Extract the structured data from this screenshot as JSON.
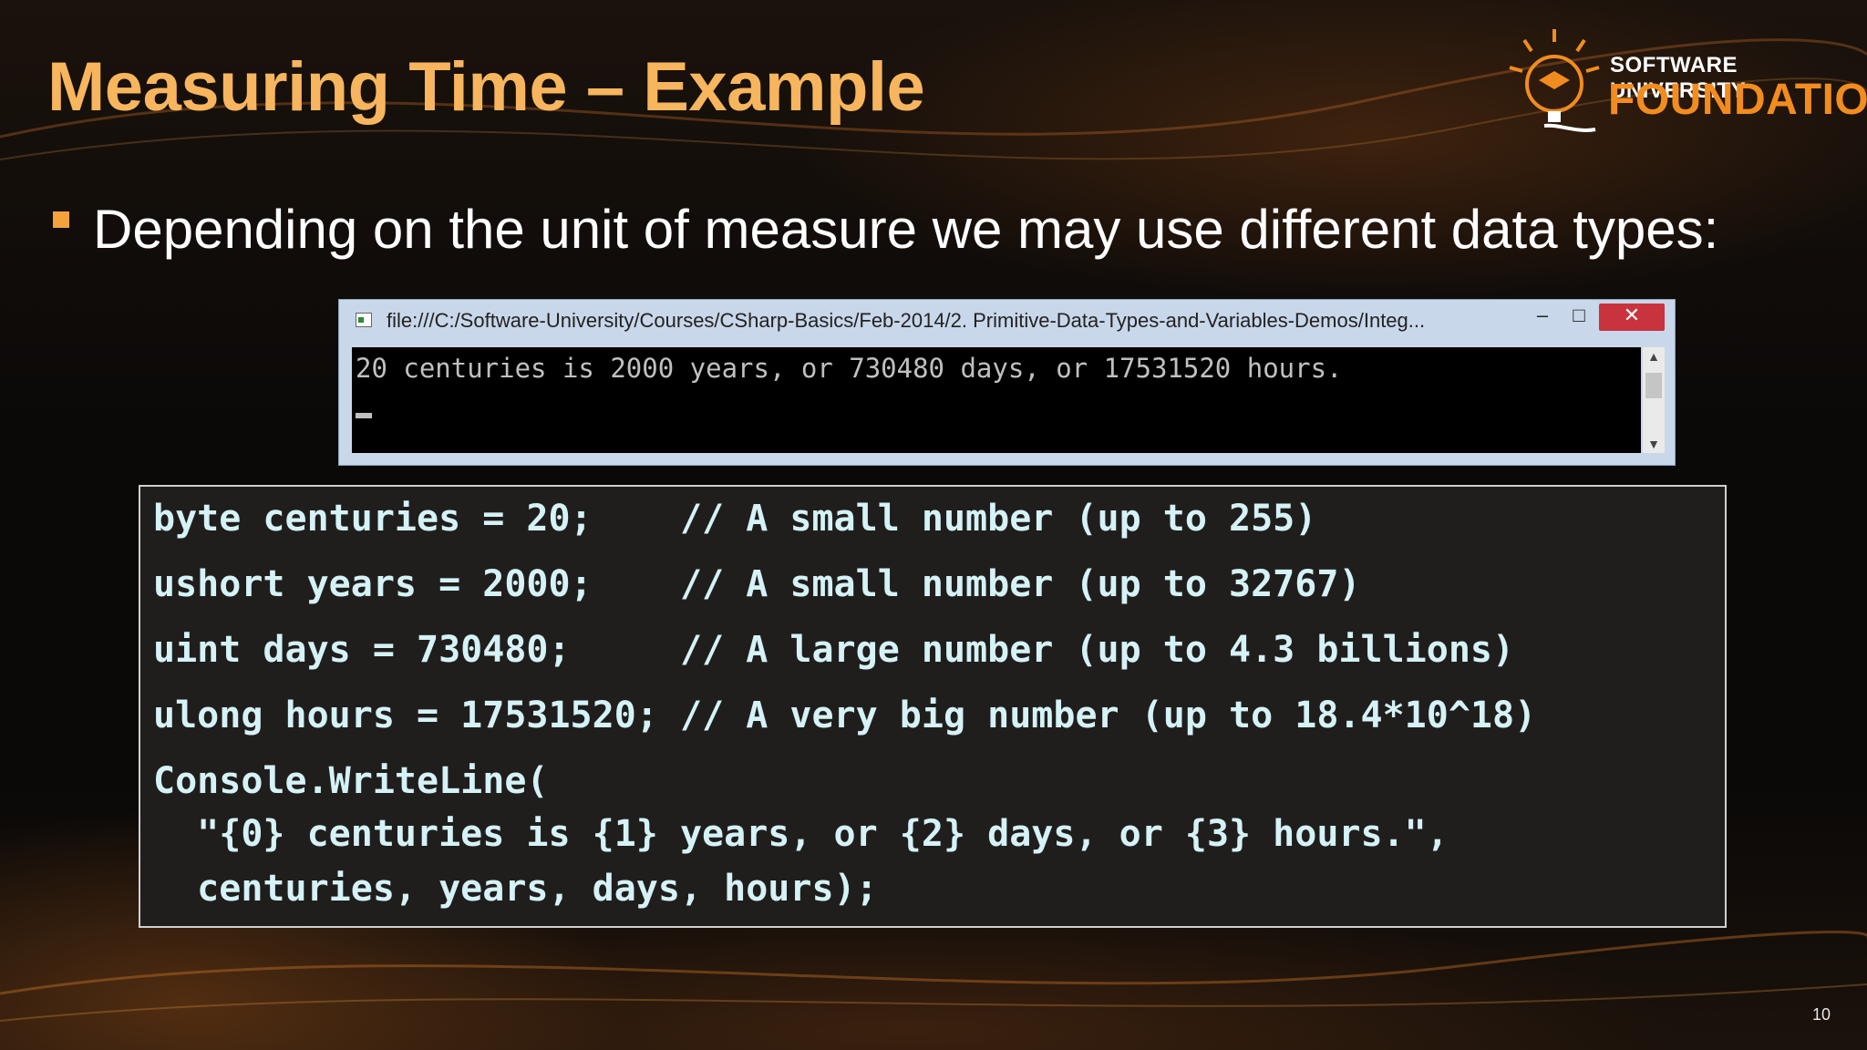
{
  "slide": {
    "title": "Measuring Time – Example",
    "bullet_text": "Depending on the unit of measure we may use different data types:",
    "page_number": "10"
  },
  "logo": {
    "line1": "SOFTWARE UNIVERSITY",
    "line2": "FOUNDATION"
  },
  "console_window": {
    "title": "file:///C:/Software-University/Courses/CSharp-Basics/Feb-2014/2. Primitive-Data-Types-and-Variables-Demos/Integ...",
    "output_line": "20 centuries is 2000 years, or 730480 days, or 17531520 hours.",
    "minimize_label": "–",
    "maximize_label": "□",
    "close_label": "✕"
  },
  "code": {
    "lines": [
      "byte centuries = 20;    // A small number (up to 255)",
      "ushort years = 2000;    // A small number (up to 32767)",
      "uint days = 730480;     // A large number (up to 4.3 billions)",
      "ulong hours = 17531520; // A very big number (up to 18.4*10^18)",
      "Console.WriteLine(",
      "  \"{0} centuries is {1} years, or {2} days, or {3} hours.\",",
      "  centuries, years, days, hours);"
    ]
  },
  "colors": {
    "title": "#f7b55e",
    "bullet": "#f4a23b",
    "code_text": "#d5f2f6",
    "logo_accent": "#f28c1e"
  }
}
